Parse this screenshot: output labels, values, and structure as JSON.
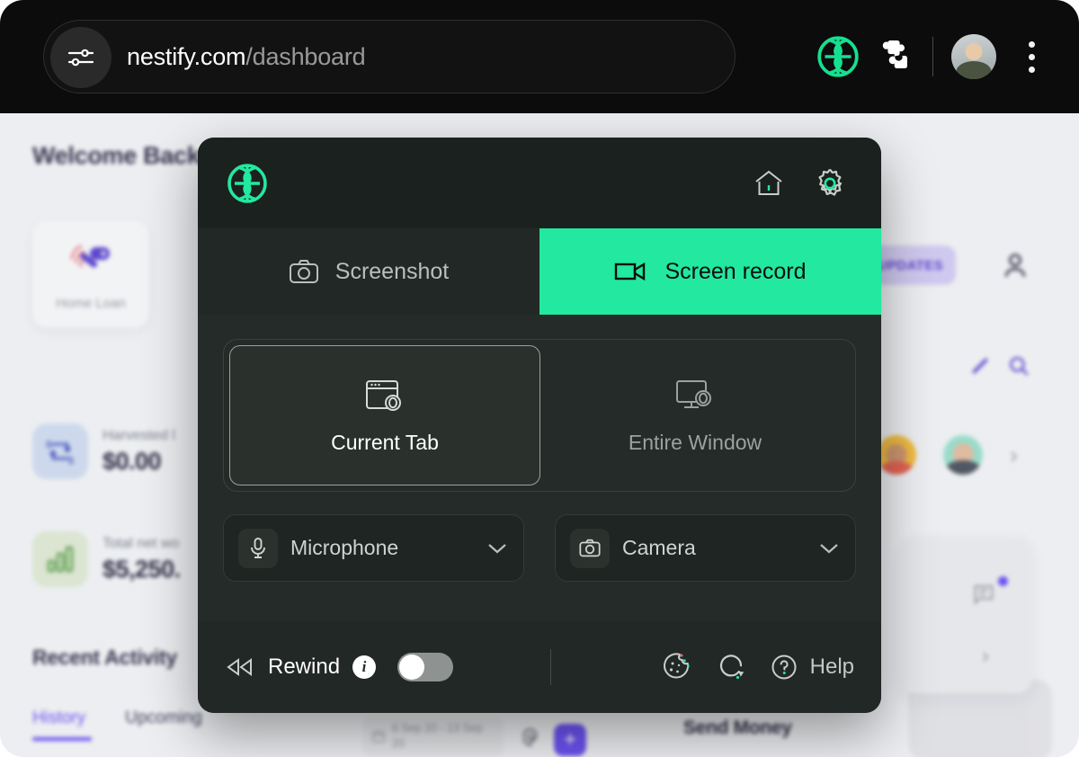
{
  "browser": {
    "url_domain": "nestify.com",
    "url_path": "/dashboard",
    "icons": {
      "omnibox_settings": "sliders-icon",
      "brand_extension": "nestify-logo-icon",
      "extensions": "puzzle-piece-icon",
      "profile": "profile-avatar",
      "menu": "kebab-menu-icon"
    }
  },
  "page": {
    "welcome_title": "Welcome Back",
    "updates_badge": "UPDATES",
    "loan_card": {
      "label": "Home Loan",
      "icon": "key-icon"
    },
    "stats": [
      {
        "label": "Harvested l",
        "value": "$0.00",
        "icon": "transfer-icon"
      },
      {
        "label": "Total net wo",
        "value": "$5,250.",
        "icon": "bar-chart-icon"
      }
    ],
    "recent_activity_title": "Recent Activity",
    "activity_tabs": [
      {
        "label": "History",
        "active": true
      },
      {
        "label": "Upcoming",
        "active": false
      }
    ],
    "date_range": "6 Sep 20 - 13 Sep 20",
    "add_button": "+",
    "send_money_title": "Send Money"
  },
  "extension": {
    "title_logo": "nestify-logo-icon",
    "header_actions": [
      {
        "name": "home-icon",
        "label": "Home"
      },
      {
        "name": "gear-icon",
        "label": "Settings"
      }
    ],
    "tabs": [
      {
        "label": "Screenshot",
        "icon": "camera-icon",
        "active": false
      },
      {
        "label": "Screen record",
        "icon": "video-camera-icon",
        "active": true
      }
    ],
    "sources": [
      {
        "label": "Current Tab",
        "icon": "browser-window-record-icon",
        "selected": true
      },
      {
        "label": "Entire Window",
        "icon": "monitor-record-icon",
        "selected": false
      }
    ],
    "devices": [
      {
        "label": "Microphone",
        "icon": "microphone-icon"
      },
      {
        "label": "Camera",
        "icon": "camera-icon"
      }
    ],
    "footer": {
      "rewind_label": "Rewind",
      "rewind_info": "i",
      "rewind_enabled": false,
      "help_label": "Help",
      "icons": [
        {
          "name": "cookie-icon"
        },
        {
          "name": "refresh-icon"
        },
        {
          "name": "question-circle-icon"
        }
      ]
    }
  },
  "colors": {
    "accent_green": "#22e8a0",
    "panel_bg": "#242b28",
    "panel_header_bg": "#1b211e",
    "brand_purple": "#5b3df0",
    "chrome_bg": "#0c0c0c"
  }
}
